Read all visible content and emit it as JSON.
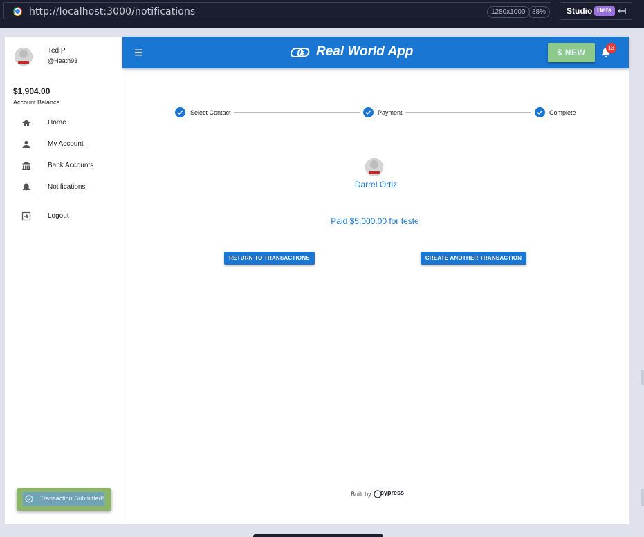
{
  "browser": {
    "url": "http://localhost:3000/notifications",
    "viewport": "1280x1000",
    "zoom": "88%",
    "studio_label": "Studio",
    "beta_label": "Beta"
  },
  "sidebar": {
    "user_name": "Ted P",
    "user_handle": "@Heath93",
    "balance": "$1,904.00",
    "balance_label": "Account Balance",
    "items": [
      {
        "label": "Home",
        "icon": "home-icon"
      },
      {
        "label": "My Account",
        "icon": "person-icon"
      },
      {
        "label": "Bank Accounts",
        "icon": "bank-icon"
      },
      {
        "label": "Notifications",
        "icon": "bell-icon"
      },
      {
        "label": "Logout",
        "icon": "logout-icon"
      }
    ]
  },
  "header": {
    "app_title": "Real World App",
    "new_button": "$ NEW",
    "notification_count": "13"
  },
  "stepper": {
    "steps": [
      "Select Contact",
      "Payment",
      "Complete"
    ]
  },
  "transaction": {
    "contact_name": "Darrel Ortiz",
    "summary": "Paid $5,000.00 for teste",
    "return_button": "RETURN TO TRANSACTIONS",
    "create_button": "CREATE ANOTHER TRANSACTION"
  },
  "toast": {
    "message": "Transaction Submitted!"
  },
  "footer": {
    "built_by": "Built by",
    "brand": "cypress"
  },
  "colors": {
    "primary": "#1976d2",
    "new_button": "#8dc98a",
    "badge": "#e53935",
    "toast": "#8db569"
  }
}
